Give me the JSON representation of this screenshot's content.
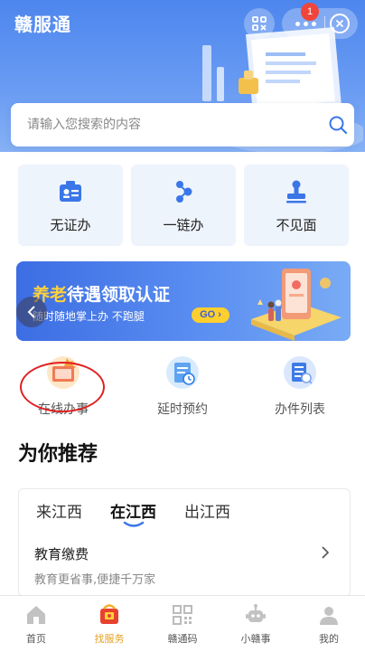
{
  "header": {
    "title": "赣服通",
    "badge_count": "1",
    "bg_color": "#4d86ee"
  },
  "search": {
    "placeholder": "请输入您搜索的内容",
    "icon": "search-icon"
  },
  "service_cards": [
    {
      "label": "无证办",
      "icon": "id-card-icon"
    },
    {
      "label": "一链办",
      "icon": "share-link-icon"
    },
    {
      "label": "不见面",
      "icon": "stamp-icon"
    }
  ],
  "banner": {
    "title_highlight": "养老",
    "title_rest": "待遇领取认证",
    "subtitle": "随时随地掌上办 不跑腿",
    "go_label": "GO"
  },
  "quick_items": [
    {
      "label": "在线办事",
      "icon": "online-service-icon"
    },
    {
      "label": "延时预约",
      "icon": "clock-appointment-icon"
    },
    {
      "label": "办件列表",
      "icon": "document-list-icon"
    }
  ],
  "recommend": {
    "title": "为你推荐",
    "tabs": [
      "来江西",
      "在江西",
      "出江西"
    ],
    "active_tab": 1,
    "item": {
      "title": "教育缴费",
      "subtitle": "教育更省事,便捷千万家"
    }
  },
  "tabbar": [
    {
      "label": "首页",
      "icon": "home-icon"
    },
    {
      "label": "找服务",
      "icon": "find-service-icon",
      "active": true
    },
    {
      "label": "赣通码",
      "icon": "qr-code-icon"
    },
    {
      "label": "小赣事",
      "icon": "robot-icon"
    },
    {
      "label": "我的",
      "icon": "user-icon"
    }
  ],
  "colors": {
    "accent_blue": "#3c6de3",
    "active_tab_orange": "#e7a21e",
    "highlight_yellow": "#ffd23a",
    "annotation_red": "#e02020"
  }
}
